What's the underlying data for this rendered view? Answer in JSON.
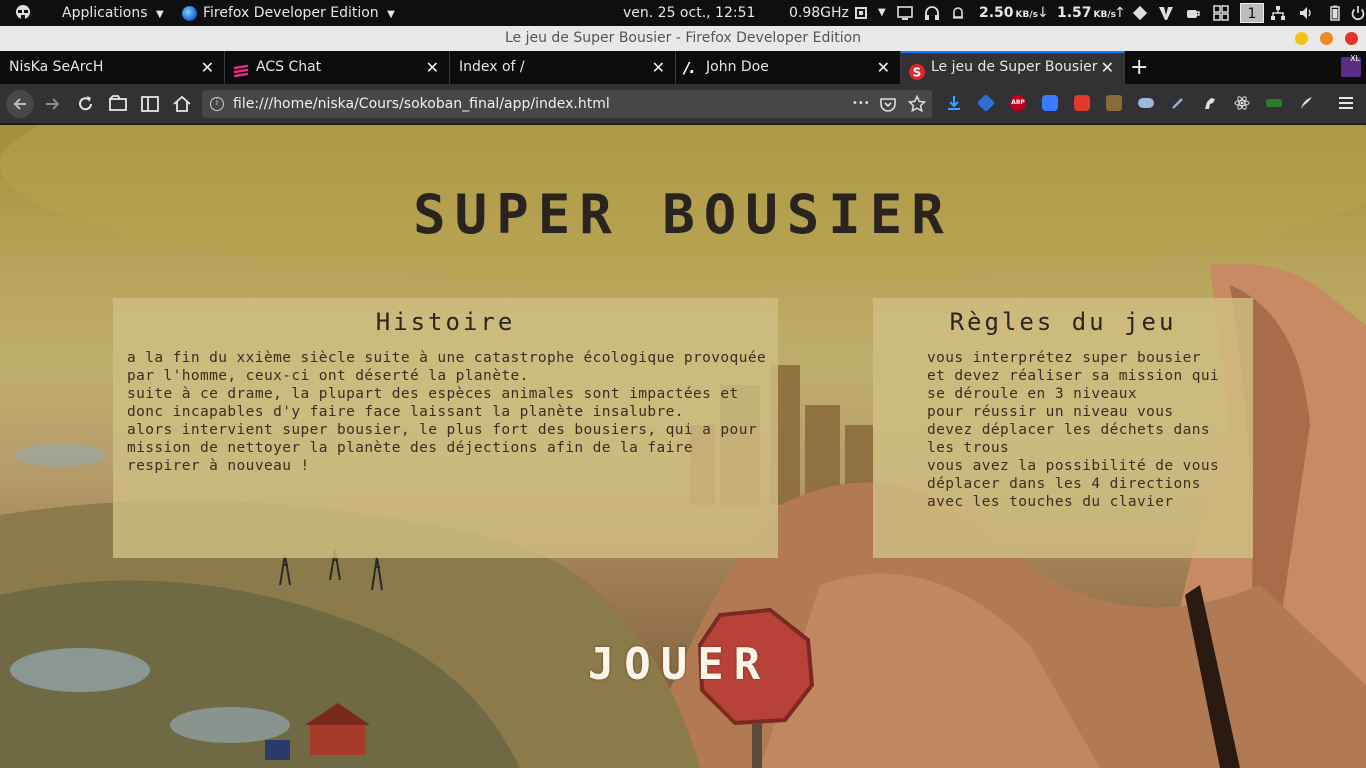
{
  "topbar": {
    "applications_label": "Applications",
    "app_label": "Firefox Developer Edition",
    "clock": "ven. 25 oct., 12:51",
    "cpu": "0.98GHz",
    "down_speed": "2.50",
    "down_unit": "KB/s",
    "up_speed": "1.57",
    "up_unit": "KB/s",
    "workspace": "1"
  },
  "window": {
    "title": "Le jeu de Super Bousier - Firefox Developer Edition"
  },
  "tabs": [
    {
      "label": "NisKa SeArcH"
    },
    {
      "label": "ACS Chat"
    },
    {
      "label": "Index of /"
    },
    {
      "label": "John Doe"
    },
    {
      "label": "Le jeu de Super Bousier"
    }
  ],
  "tab_close_glyph": "✕",
  "new_tab_glyph": "+",
  "navbar": {
    "url": "file:///home/niska/Cours/sokoban_final/app/index.html",
    "more_glyph": "•••",
    "abp_label": "ABP",
    "badge_xl": "XL"
  },
  "page": {
    "title": "Super Bousier",
    "histoire": {
      "heading": "Histoire",
      "body": "A la fin du XXième siècle suite à une catastrophe écologique provoquée par l'Homme, ceux-ci ont déserté la planète.\nSuite à ce drame, la plupart des espèces animales sont impactées et donc incapables d'y faire face laissant la planète insalubre.\nAlors intervient Super Bousier, le plus fort des bousiers, qui a pour mission de nettoyer la planète des déjections afin de la faire respirer à nouveau !"
    },
    "regles": {
      "heading": "Règles du jeu",
      "body": "Vous interprétez Super Bousier et devez réaliser sa mission qui se déroule en 3 niveaux\nPour réussir un niveau vous devez déplacer les déchets dans les trous\nVous avez la possibilité de vous déplacer dans les 4 directions avec les touches du clavier"
    },
    "play_label": "Jouer"
  },
  "colors": {
    "accent": "#0a84ff",
    "panel": "#d0be82",
    "title_text": "#2a2420"
  }
}
